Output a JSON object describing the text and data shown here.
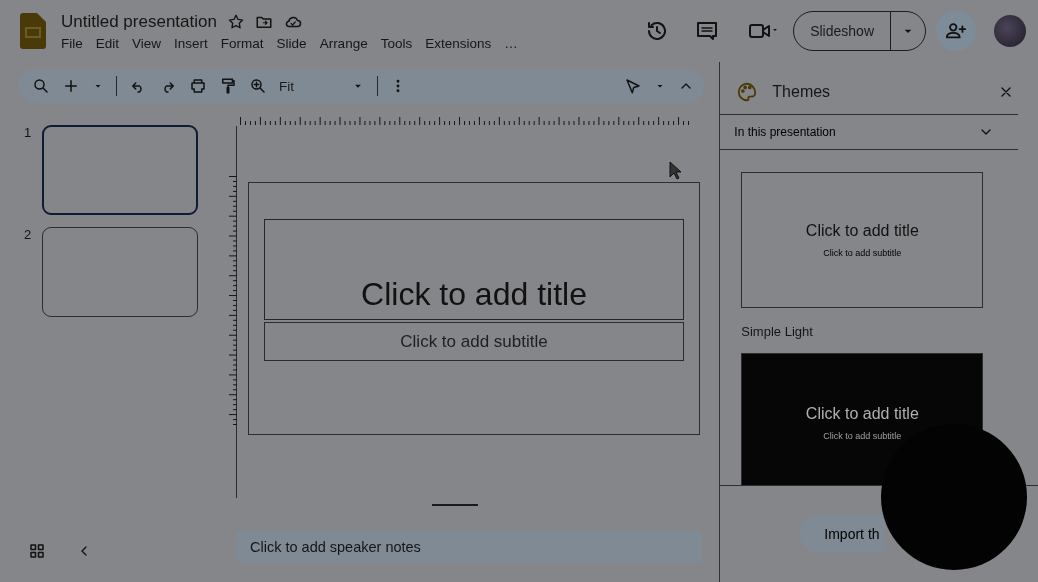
{
  "document": {
    "title": "Untitled presentation"
  },
  "menu": [
    "File",
    "Edit",
    "View",
    "Insert",
    "Format",
    "Slide",
    "Arrange",
    "Tools",
    "Extensions",
    "…"
  ],
  "toolbar": {
    "zoom": "Fit"
  },
  "slideshow_button": "Slideshow",
  "filmstrip": [
    {
      "number": "1",
      "selected": true
    },
    {
      "number": "2",
      "selected": false
    }
  ],
  "slide": {
    "title": "Click to add title",
    "subtitle": "Click to add subtitle"
  },
  "speaker_notes": {
    "placeholder": "Click to add speaker notes"
  },
  "themes_panel": {
    "title": "Themes",
    "filter": "In this presentation",
    "themes": [
      {
        "kind": "light",
        "title": "Click to add title",
        "subtitle": "Click to add subtitle",
        "name": "Simple Light"
      },
      {
        "kind": "dark",
        "title": "Click to add title",
        "subtitle": "Click to add subtitle"
      }
    ],
    "import_button": "Import th"
  }
}
